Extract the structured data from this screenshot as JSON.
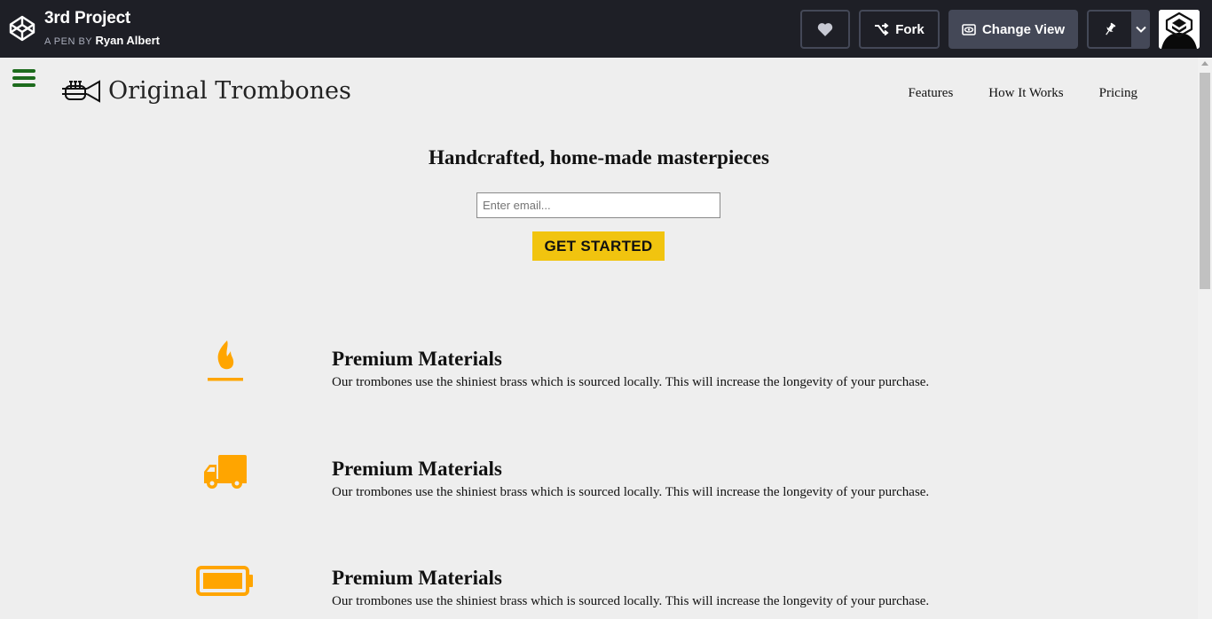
{
  "codepen": {
    "pen_title": "3rd Project",
    "byline_prefix": "A PEN BY",
    "author": "Ryan Albert",
    "buttons": {
      "fork": "Fork",
      "change_view": "Change View"
    },
    "icons": [
      "codepen-logo-icon",
      "heart-icon",
      "fork-icon",
      "eye-icon",
      "pin-icon",
      "chevron-down-icon"
    ]
  },
  "site": {
    "logo_text": "Original Trombones",
    "nav": [
      "Features",
      "How It Works",
      "Pricing"
    ],
    "hero": {
      "title": "Handcrafted, home-made masterpieces",
      "email_placeholder": "Enter email...",
      "cta": "GET STARTED"
    },
    "features": [
      {
        "icon": "fire-icon",
        "title": "Premium Materials",
        "text": "Our trombones use the shiniest brass which is sourced locally. This will increase the longevity of your purchase."
      },
      {
        "icon": "truck-icon",
        "title": "Premium Materials",
        "text": "Our trombones use the shiniest brass which is sourced locally. This will increase the longevity of your purchase."
      },
      {
        "icon": "battery-icon",
        "title": "Premium Materials",
        "text": "Our trombones use the shiniest brass which is sourced locally. This will increase the longevity of your purchase."
      }
    ],
    "colors": {
      "accent_icon": "#ffa500",
      "cta_background": "#f1c40f",
      "hamburger": "#1d6b1d",
      "page_background": "#eeeeee",
      "topbar_background": "#1e1f26"
    }
  }
}
